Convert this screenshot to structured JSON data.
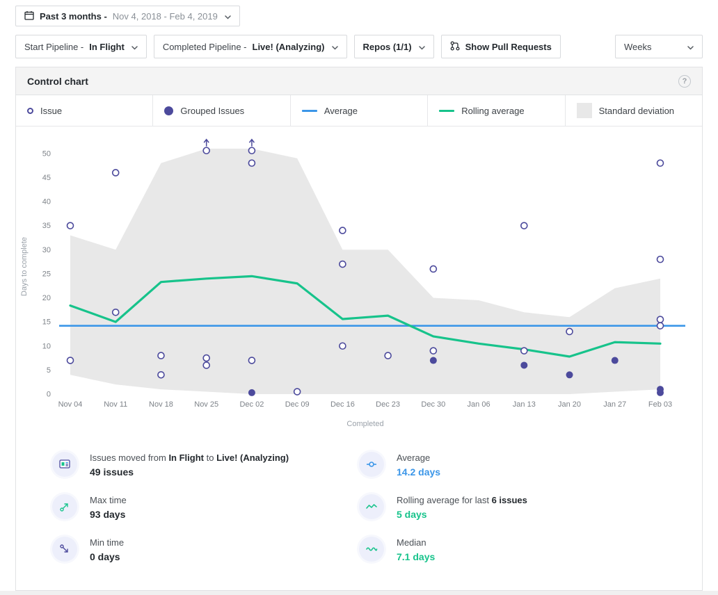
{
  "colors": {
    "blue": "#3b96e8",
    "green": "#17c38b",
    "indigo": "#4c4a9c",
    "band": "#e8e8e8"
  },
  "date_range": {
    "period": "Past 3 months -",
    "dates": "Nov 4, 2018 - Feb 4, 2019"
  },
  "filters": {
    "start_pipeline_prefix": "Start Pipeline - ",
    "start_pipeline_value": "In Flight",
    "completed_pipeline_prefix": "Completed Pipeline - ",
    "completed_pipeline_value": "Live! (Analyzing)",
    "repos_label": "Repos (1/1)",
    "show_pull_requests_label": "Show Pull Requests",
    "interval_value": "Weeks"
  },
  "panel": {
    "title": "Control chart",
    "help": "?"
  },
  "legend": {
    "issue": "Issue",
    "grouped_issues": "Grouped Issues",
    "average": "Average",
    "rolling_average": "Rolling average",
    "standard_deviation": "Standard deviation"
  },
  "chart_data": {
    "type": "scatter",
    "title": "Control chart",
    "xlabel": "Completed",
    "ylabel": "Days to complete",
    "ylim": [
      0,
      53
    ],
    "yticks": [
      0,
      5,
      10,
      15,
      20,
      25,
      30,
      35,
      40,
      45,
      50
    ],
    "categories": [
      "Nov 04",
      "Nov 11",
      "Nov 18",
      "Nov 25",
      "Dec 02",
      "Dec 09",
      "Dec 16",
      "Dec 23",
      "Dec 30",
      "Jan 06",
      "Jan 13",
      "Jan 20",
      "Jan 27",
      "Feb 03"
    ],
    "average_days": 14.2,
    "rolling_average": [
      18.4,
      15,
      23.3,
      24,
      24.5,
      23,
      15.6,
      16.3,
      12,
      10.5,
      9.3,
      7.8,
      10.8,
      10.5
    ],
    "std_band_upper": [
      33,
      30,
      48,
      51,
      51,
      49,
      30,
      30,
      20,
      19.5,
      17,
      16,
      22,
      24
    ],
    "std_band_lower": [
      4,
      2,
      1,
      0.5,
      0,
      0,
      0,
      0,
      0,
      0,
      0,
      0,
      0.5,
      1
    ],
    "issues": [
      [
        0,
        35
      ],
      [
        0,
        7
      ],
      [
        1,
        46
      ],
      [
        1,
        17
      ],
      [
        2,
        8
      ],
      [
        2,
        4
      ],
      [
        3,
        7.5
      ],
      [
        3,
        6
      ],
      [
        4,
        48
      ],
      [
        4,
        7
      ],
      [
        5,
        0.5
      ],
      [
        6,
        34
      ],
      [
        6,
        27
      ],
      [
        6,
        10
      ],
      [
        7,
        8
      ],
      [
        8,
        26
      ],
      [
        8,
        9
      ],
      [
        10,
        35
      ],
      [
        10,
        9
      ],
      [
        11,
        13
      ],
      [
        13,
        48
      ],
      [
        13,
        28
      ],
      [
        13,
        15.5
      ],
      [
        13,
        14.2
      ]
    ],
    "grouped_issues": [
      [
        4,
        0.3
      ],
      [
        8,
        7
      ],
      [
        10,
        6
      ],
      [
        11,
        4
      ],
      [
        12,
        7
      ],
      [
        13,
        1
      ],
      [
        13,
        0.3
      ]
    ],
    "clipped_issues": [
      3,
      4
    ],
    "legend_position": "top",
    "grid": false
  },
  "stats": {
    "issues_moved": {
      "prefix": "Issues moved from ",
      "from": "In Flight",
      "mid": " to ",
      "to": "Live! (Analyzing)",
      "value": "49 issues"
    },
    "max_time": {
      "label": "Max time",
      "value": "93 days"
    },
    "min_time": {
      "label": "Min time",
      "value": "0 days"
    },
    "average": {
      "label": "Average",
      "value": "14.2 days"
    },
    "rolling_average": {
      "prefix": "Rolling average for last ",
      "count": "6 issues",
      "value": "5 days"
    },
    "median": {
      "label": "Median",
      "value": "7.1 days"
    }
  }
}
